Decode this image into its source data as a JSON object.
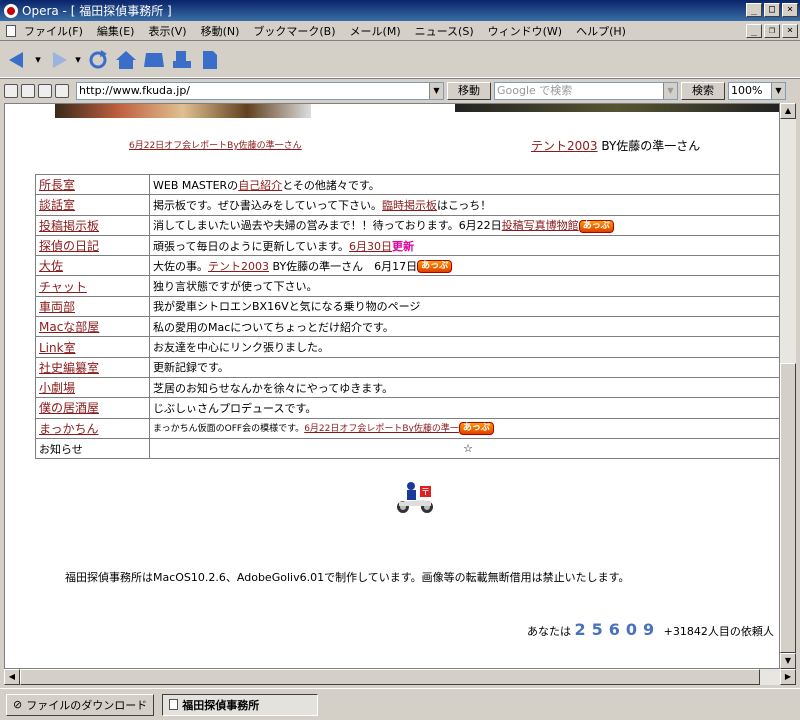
{
  "window": {
    "title": "Opera - [ 福田探偵事務所 ]",
    "controls": [
      "_",
      "□",
      "×"
    ],
    "mdi_controls": [
      "_",
      "❐",
      "×"
    ]
  },
  "menu": [
    "ファイル(F)",
    "編集(E)",
    "表示(V)",
    "移動(N)",
    "ブックマーク(B)",
    "メール(M)",
    "ニュース(S)",
    "ウィンドウ(W)",
    "ヘルプ(H)"
  ],
  "address": {
    "url": "http://www.fkuda.jp/",
    "go_label": "移動",
    "search_placeholder": "Google で検索",
    "search_label": "検索",
    "zoom": "100%"
  },
  "captions": {
    "left": "6月22日オフ会レポートBy佐藤の準一さん",
    "right_link": "テント2003",
    "right_text": " BY佐藤の準一さん"
  },
  "rows": [
    {
      "name": "所長室",
      "parts": [
        {
          "t": "WEB MASTERの"
        },
        {
          "t": "自己紹介",
          "link": true
        },
        {
          "t": "とその他諸々です。"
        }
      ]
    },
    {
      "name": "談話室",
      "parts": [
        {
          "t": "掲示板です。ぜひ書込みをしていって下さい。"
        },
        {
          "t": "臨時掲示板",
          "link": true
        },
        {
          "t": "はこっち！"
        }
      ]
    },
    {
      "name": "投稿掲示板",
      "parts": [
        {
          "t": "消してしまいたい過去や夫婦の営みまで！！待っております。6月22日"
        },
        {
          "t": "投稿写真博物館",
          "link": true
        },
        {
          "t": "あっぷ",
          "badge": true
        }
      ]
    },
    {
      "name": "探偵の日記",
      "parts": [
        {
          "t": "頑張って毎日のように更新しています。"
        },
        {
          "t": "6月30日",
          "link": true
        },
        {
          "t": "更新",
          "magenta": true
        }
      ]
    },
    {
      "name": "大佐",
      "parts": [
        {
          "t": "大佐の事。"
        },
        {
          "t": "テント2003",
          "link": true
        },
        {
          "t": " BY佐藤の準一さん　6月17日"
        },
        {
          "t": "あっぷ",
          "badge": true
        }
      ]
    },
    {
      "name": "チャット",
      "parts": [
        {
          "t": "独り言状態ですが使って下さい。"
        }
      ]
    },
    {
      "name": "車両部",
      "parts": [
        {
          "t": "我が愛車シトロエンBX16Vと気になる乗り物のページ"
        }
      ]
    },
    {
      "name": "Macな部屋",
      "parts": [
        {
          "t": "私の愛用のMacについてちょっとだけ紹介です。"
        }
      ]
    },
    {
      "name": "Link室",
      "parts": [
        {
          "t": "お友達を中心にリンク張りました。"
        }
      ]
    },
    {
      "name": "社史編纂室",
      "parts": [
        {
          "t": "更新記録です。"
        }
      ]
    },
    {
      "name": "小劇場",
      "parts": [
        {
          "t": "芝居のお知らせなんかを徐々にやってゆきます。"
        }
      ]
    },
    {
      "name": "僕の居酒屋",
      "parts": [
        {
          "t": "じぶしぃさんプロデュースです。"
        }
      ]
    },
    {
      "name": "まっかちん",
      "parts": [
        {
          "t": "まっかちん仮面のOFF会の模様です。",
          "small": true
        },
        {
          "t": "6月22日オフ会レポートBy佐藤の準一",
          "link": true,
          "small": true
        },
        {
          "t": "あっぷ",
          "badge": true
        }
      ]
    },
    {
      "name": "お知らせ",
      "plain": true,
      "parts": [
        {
          "t": "☆",
          "center": true
        }
      ]
    }
  ],
  "footer": {
    "text": "福田探偵事務所はMacOS10.2.6、AdobeGoliv6.01で制作しています。画像等の転載無断借用は禁止いたします。",
    "counter_prefix": "あなたは",
    "counter_digits": "25609",
    "counter_suffix": "+31842人目の依頼人"
  },
  "taskbar": {
    "download_label": "ファイルのダウンロード",
    "active_tab": "福田探偵事務所"
  }
}
